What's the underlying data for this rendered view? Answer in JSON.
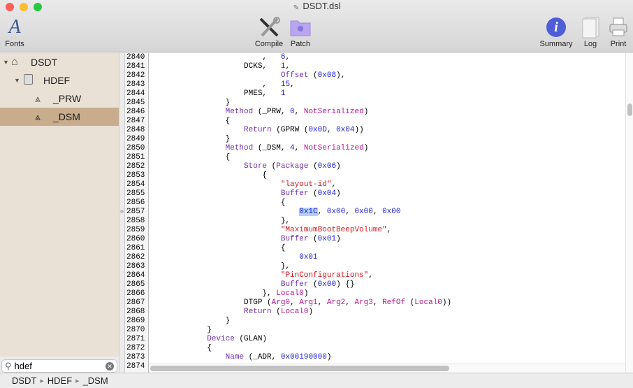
{
  "window": {
    "title": "DSDT.dsl"
  },
  "toolbar": {
    "fonts": "Fonts",
    "compile": "Compile",
    "patch": "Patch",
    "summary": "Summary",
    "log": "Log",
    "print": "Print"
  },
  "sidebar": {
    "tree": [
      {
        "label": "DSDT",
        "icon": "house-icon",
        "expanded": true
      },
      {
        "label": "HDEF",
        "icon": "drive-icon",
        "expanded": true
      },
      {
        "label": "_PRW",
        "icon": "method-icon"
      },
      {
        "label": "_DSM",
        "icon": "method-icon",
        "selected": true
      }
    ],
    "search": {
      "value": "hdef"
    }
  },
  "breadcrumb": [
    "DSDT",
    "HDEF",
    "_DSM"
  ],
  "colors": {
    "keyword": "#6f2ea8",
    "number": "#2020d2",
    "string": "#d2141c",
    "builtin": "#b5168e",
    "selection": "#c8ad8d",
    "highlight": "#b3d0f5"
  },
  "editor": {
    "lines": [
      {
        "num": "2840",
        "t": [
          [
            "p",
            "                        ,   "
          ],
          [
            "n",
            "6"
          ],
          [
            "p",
            ","
          ]
        ]
      },
      {
        "num": "2841",
        "t": [
          [
            "p",
            "                    DCKS,   "
          ],
          [
            "n",
            "1"
          ],
          [
            "p",
            ","
          ]
        ]
      },
      {
        "num": "2842",
        "t": [
          [
            "p",
            "                            "
          ],
          [
            "k",
            "Offset"
          ],
          [
            "p",
            " ("
          ],
          [
            "n",
            "0x08"
          ],
          [
            "p",
            "),"
          ]
        ]
      },
      {
        "num": "2843",
        "t": [
          [
            "p",
            "                        ,   "
          ],
          [
            "n",
            "15"
          ],
          [
            "p",
            ","
          ]
        ]
      },
      {
        "num": "2844",
        "t": [
          [
            "p",
            "                    PMES,   "
          ],
          [
            "n",
            "1"
          ]
        ]
      },
      {
        "num": "2845",
        "t": [
          [
            "p",
            "                }"
          ]
        ]
      },
      {
        "num": "2846",
        "t": [
          [
            "p",
            "                "
          ],
          [
            "k",
            "Method"
          ],
          [
            "p",
            " (_PRW, "
          ],
          [
            "n",
            "0"
          ],
          [
            "p",
            ", "
          ],
          [
            "m",
            "NotSerialized"
          ],
          [
            "p",
            ")"
          ]
        ]
      },
      {
        "num": "2847",
        "t": [
          [
            "p",
            "                {"
          ]
        ]
      },
      {
        "num": "2848",
        "t": [
          [
            "p",
            "                    "
          ],
          [
            "k",
            "Return"
          ],
          [
            "p",
            " (GPRW ("
          ],
          [
            "n",
            "0x0D"
          ],
          [
            "p",
            ", "
          ],
          [
            "n",
            "0x04"
          ],
          [
            "p",
            "))"
          ]
        ]
      },
      {
        "num": "2849",
        "t": [
          [
            "p",
            "                }"
          ]
        ]
      },
      {
        "num": "2850",
        "t": [
          [
            "p",
            "                "
          ],
          [
            "k",
            "Method"
          ],
          [
            "p",
            " (_DSM, "
          ],
          [
            "n",
            "4"
          ],
          [
            "p",
            ", "
          ],
          [
            "m",
            "NotSerialized"
          ],
          [
            "p",
            ")"
          ]
        ]
      },
      {
        "num": "2851",
        "t": [
          [
            "p",
            "                {"
          ]
        ]
      },
      {
        "num": "2852",
        "t": [
          [
            "p",
            "                    "
          ],
          [
            "k",
            "Store"
          ],
          [
            "p",
            " ("
          ],
          [
            "k",
            "Package"
          ],
          [
            "p",
            " ("
          ],
          [
            "n",
            "0x06"
          ],
          [
            "p",
            ")"
          ]
        ]
      },
      {
        "num": "2853",
        "t": [
          [
            "p",
            "                        {"
          ]
        ]
      },
      {
        "num": "2854",
        "t": [
          [
            "p",
            "                            "
          ],
          [
            "s",
            "\"layout-id\""
          ],
          [
            "p",
            ","
          ]
        ]
      },
      {
        "num": "2855",
        "t": [
          [
            "p",
            "                            "
          ],
          [
            "k",
            "Buffer"
          ],
          [
            "p",
            " ("
          ],
          [
            "n",
            "0x04"
          ],
          [
            "p",
            ")"
          ]
        ]
      },
      {
        "num": "2856",
        "t": [
          [
            "p",
            "                            {"
          ]
        ]
      },
      {
        "num": "2857",
        "t": [
          [
            "p",
            "                                "
          ],
          [
            "n h",
            "0x1C"
          ],
          [
            "p",
            ", "
          ],
          [
            "n",
            "0x00"
          ],
          [
            "p",
            ", "
          ],
          [
            "n",
            "0x00"
          ],
          [
            "p",
            ", "
          ],
          [
            "n",
            "0x00"
          ]
        ]
      },
      {
        "num": "2858",
        "t": [
          [
            "p",
            "                            },"
          ]
        ]
      },
      {
        "num": "2859",
        "t": [
          [
            "p",
            "                            "
          ],
          [
            "s",
            "\"MaximumBootBeepVolume\""
          ],
          [
            "p",
            ","
          ]
        ]
      },
      {
        "num": "2860",
        "t": [
          [
            "p",
            "                            "
          ],
          [
            "k",
            "Buffer"
          ],
          [
            "p",
            " ("
          ],
          [
            "n",
            "0x01"
          ],
          [
            "p",
            ")"
          ]
        ]
      },
      {
        "num": "2861",
        "t": [
          [
            "p",
            "                            {"
          ]
        ]
      },
      {
        "num": "2862",
        "t": [
          [
            "p",
            "                                "
          ],
          [
            "n",
            "0x01"
          ]
        ]
      },
      {
        "num": "2863",
        "t": [
          [
            "p",
            "                            },"
          ]
        ]
      },
      {
        "num": "2864",
        "t": [
          [
            "p",
            "                            "
          ],
          [
            "s",
            "\"PinConfigurations\""
          ],
          [
            "p",
            ","
          ]
        ]
      },
      {
        "num": "2865",
        "t": [
          [
            "p",
            "                            "
          ],
          [
            "k",
            "Buffer"
          ],
          [
            "p",
            " ("
          ],
          [
            "n",
            "0x00"
          ],
          [
            "p",
            ") {}"
          ]
        ]
      },
      {
        "num": "2866",
        "t": [
          [
            "p",
            "                        }, "
          ],
          [
            "m",
            "Local0"
          ],
          [
            "p",
            ")"
          ]
        ]
      },
      {
        "num": "2867",
        "t": [
          [
            "p",
            "                    DTGP ("
          ],
          [
            "m",
            "Arg0"
          ],
          [
            "p",
            ", "
          ],
          [
            "m",
            "Arg1"
          ],
          [
            "p",
            ", "
          ],
          [
            "m",
            "Arg2"
          ],
          [
            "p",
            ", "
          ],
          [
            "m",
            "Arg3"
          ],
          [
            "p",
            ", "
          ],
          [
            "m",
            "RefOf"
          ],
          [
            "p",
            " ("
          ],
          [
            "m",
            "Local0"
          ],
          [
            "p",
            "))"
          ]
        ]
      },
      {
        "num": "2868",
        "t": [
          [
            "p",
            "                    "
          ],
          [
            "k",
            "Return"
          ],
          [
            "p",
            " ("
          ],
          [
            "m",
            "Local0"
          ],
          [
            "p",
            ")"
          ]
        ]
      },
      {
        "num": "2869",
        "t": [
          [
            "p",
            "                }"
          ]
        ]
      },
      {
        "num": "2870",
        "t": [
          [
            "p",
            "            }"
          ]
        ]
      },
      {
        "num": "2871",
        "t": [
          [
            "p",
            "            "
          ],
          [
            "k",
            "Device"
          ],
          [
            "p",
            " (GLAN)"
          ]
        ]
      },
      {
        "num": "2872",
        "t": [
          [
            "p",
            "            {"
          ]
        ]
      },
      {
        "num": "2873",
        "t": [
          [
            "p",
            "                "
          ],
          [
            "k",
            "Name"
          ],
          [
            "p",
            " (_ADR, "
          ],
          [
            "n",
            "0x00190000"
          ],
          [
            "p",
            ")"
          ]
        ]
      },
      {
        "num": "2874",
        "t": []
      }
    ]
  }
}
